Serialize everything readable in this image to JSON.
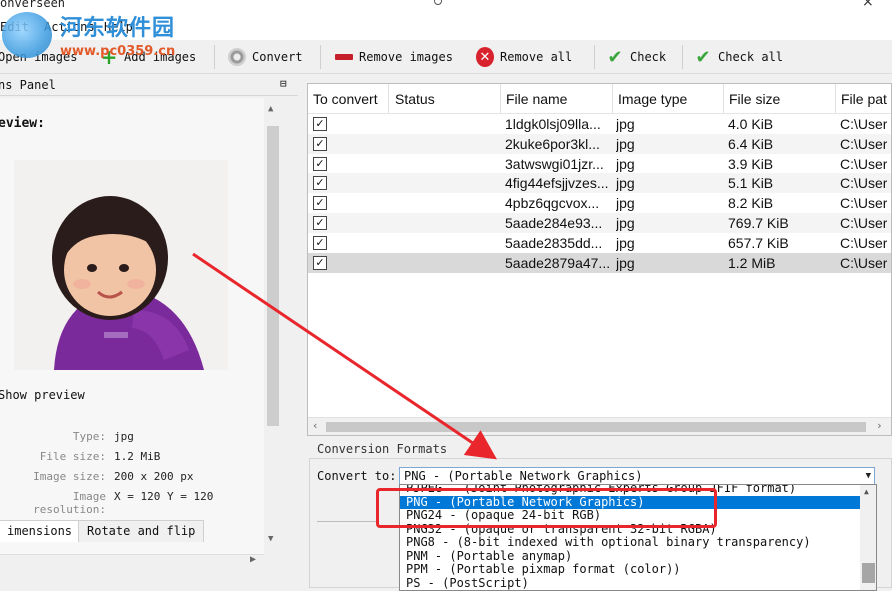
{
  "window": {
    "title": "onverseen"
  },
  "menu": {
    "edit": "Edit",
    "actions": "Actions",
    "help": "Help"
  },
  "watermark": {
    "cn": "河东软件园",
    "url": "www.pc0359.cn"
  },
  "toolbar": {
    "open_images": "Open images",
    "add_images": "Add images",
    "convert": "Convert",
    "remove_images": "Remove images",
    "remove_all": "Remove all",
    "check": "Check",
    "check_all": "Check all"
  },
  "left_panel": {
    "title": "ns Panel",
    "dock_glyph": "⊟",
    "preview_label": "eview:",
    "show_preview": "Show preview",
    "info": [
      {
        "key": "Type:",
        "value": "jpg"
      },
      {
        "key": "File size:",
        "value": "1.2 MiB"
      },
      {
        "key": "Image size:",
        "value": "200 x 200 px"
      },
      {
        "key": "Image resolution:",
        "value": "X = 120 Y = 120"
      }
    ],
    "tabs": [
      "imensions",
      "Rotate and flip"
    ]
  },
  "file_list": {
    "headers": [
      "To convert",
      "Status",
      "File name",
      "Image type",
      "File size",
      "File pat"
    ],
    "rows": [
      {
        "checked": true,
        "status": "",
        "name": "1ldgk0lsj09lla...",
        "type": "jpg",
        "size": "4.0 KiB",
        "path": "C:\\User"
      },
      {
        "checked": true,
        "status": "",
        "name": "2kuke6por3kl...",
        "type": "jpg",
        "size": "6.4 KiB",
        "path": "C:\\User"
      },
      {
        "checked": true,
        "status": "",
        "name": "3atwswgi01jzr...",
        "type": "jpg",
        "size": "3.9 KiB",
        "path": "C:\\User"
      },
      {
        "checked": true,
        "status": "",
        "name": "4fig44efsjjvzes...",
        "type": "jpg",
        "size": "5.1 KiB",
        "path": "C:\\User"
      },
      {
        "checked": true,
        "status": "",
        "name": "4pbz6qgcvox...",
        "type": "jpg",
        "size": "8.2 KiB",
        "path": "C:\\User"
      },
      {
        "checked": true,
        "status": "",
        "name": "5aade284e93...",
        "type": "jpg",
        "size": "769.7 KiB",
        "path": "C:\\User"
      },
      {
        "checked": true,
        "status": "",
        "name": "5aade2835dd...",
        "type": "jpg",
        "size": "657.7 KiB",
        "path": "C:\\User"
      },
      {
        "checked": true,
        "status": "",
        "name": "5aade2879a47...",
        "type": "jpg",
        "size": "1.2 MiB",
        "path": "C:\\User"
      }
    ],
    "check_glyph": "✓"
  },
  "conversion": {
    "title": "Conversion Formats",
    "convert_to_label": "Convert to:",
    "selected": "PNG - (Portable Network Graphics)",
    "options": [
      "PJPEG - (Joint Photographic Experts Group JFIF format)",
      "PNG - (Portable Network Graphics)",
      "PNG24 - (opaque 24-bit RGB)",
      "PNG32 - (opaque or transparent 32-bit RGBA)",
      "PNG8 - (8-bit indexed with optional binary transparency)",
      "PNM - (Portable anymap)",
      "PPM - (Portable pixmap format (color))",
      "PS - (PostScript)"
    ],
    "highlighted_index": 1
  },
  "colors": {
    "highlight": "#0078d7",
    "annotation": "#e8262b"
  }
}
